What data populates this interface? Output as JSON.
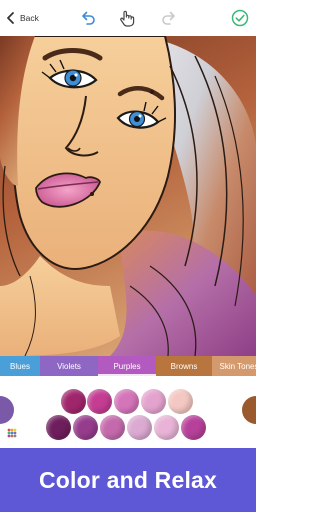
{
  "toolbar": {
    "back_label": "Back"
  },
  "color_tabs": [
    {
      "label": "Blues",
      "color": "#4a9fd8"
    },
    {
      "label": "Violets",
      "color": "#8e67c4"
    },
    {
      "label": "Purples",
      "color": "#b35ac0"
    },
    {
      "label": "Browns",
      "color": "#b8763e"
    },
    {
      "label": "Skin Tones",
      "color": "#d49a6d"
    }
  ],
  "selected_tab": "Purples",
  "palette": {
    "row1": [
      "#a0266c",
      "#c43d93",
      "#d474b9",
      "#e4a3cf",
      "#f2d0e6",
      "#f3c7c2"
    ],
    "row2": [
      "#6e1e5c",
      "#963c8c",
      "#c46aac",
      "#dba9d1",
      "#e8b3d6",
      "#b6409a",
      "#a43a92"
    ],
    "left_edge_color": "#7a5aa8",
    "right_edge_color": "#9a5a2e"
  },
  "banner": {
    "text": "Color and Relax",
    "background": "#5e57d6"
  },
  "colors": {
    "accent_green": "#3cb878",
    "icon_blue": "#3f8ad6",
    "artwork_backdrop": "#00a9a9"
  }
}
